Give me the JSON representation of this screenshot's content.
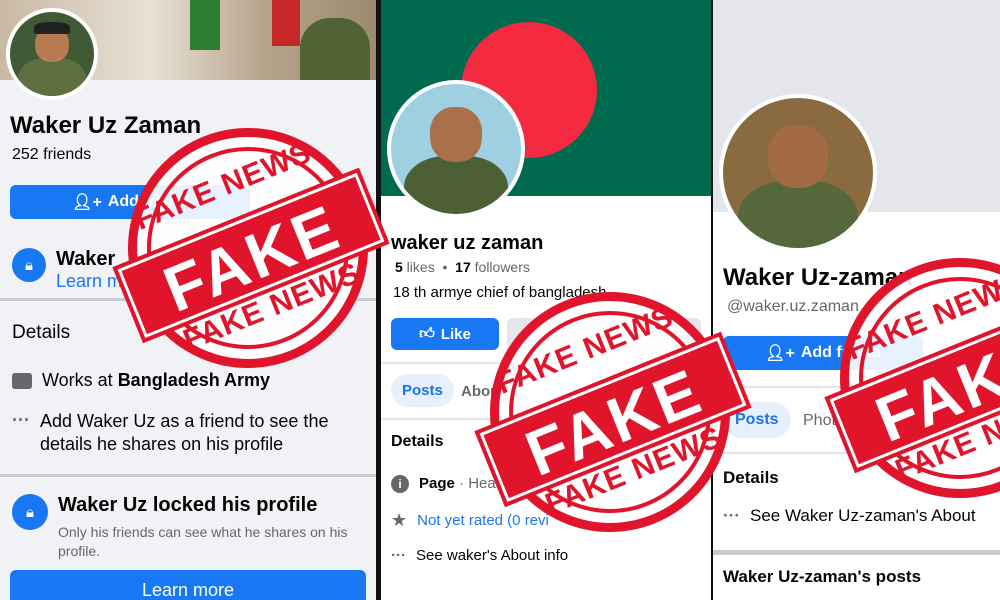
{
  "panel1": {
    "name": "Waker Uz Zaman",
    "friends": "252 friends",
    "add_friend": "Add friend",
    "locked_title_partial": "Waker",
    "learn_partial": "Learn m",
    "details_heading": "Details",
    "works_prefix": "Works at ",
    "works_place": "Bangladesh Army",
    "add_friend_note": "Add Waker Uz as a friend to see the details he shares on his profile",
    "locked_title": "Waker Uz locked his profile",
    "locked_desc": "Only his friends can see what he shares on his profile.",
    "learn_more": "Learn more"
  },
  "panel2": {
    "name": "waker uz zaman",
    "likes_count": "5",
    "likes_label": " likes",
    "followers_count": "17",
    "followers_label": " followers",
    "bio": "18 th armye chief of bangladesh",
    "like_button": "Like",
    "tab_posts": "Posts",
    "tab_about": "About",
    "details_heading": "Details",
    "page_label": "Page",
    "page_category": " · Health",
    "rating": "Not yet rated (0 revi",
    "about_info": "See waker's About info"
  },
  "panel3": {
    "name": "Waker Uz-zaman",
    "handle": "@waker.uz.zaman",
    "add_friend": "Add friend",
    "tab_posts": "Posts",
    "tab_photos": "Photo",
    "details_heading": "Details",
    "about_info": "See Waker Uz-zaman's About",
    "posts_heading": "Waker Uz-zaman's posts"
  },
  "stamp": {
    "top_text": "FAKE NEWS",
    "main_text": "FAKE",
    "bottom_text": "FAKE NEWS"
  },
  "colors": {
    "facebook_blue": "#1877f2",
    "stamp_red": "#e0142b",
    "flag_green": "#006a4e",
    "flag_red": "#f42a41"
  },
  "icons": [
    "add-person-icon",
    "shield-lock-icon",
    "briefcase-icon",
    "dots-icon",
    "thumbs-up-icon",
    "info-icon",
    "star-icon"
  ]
}
